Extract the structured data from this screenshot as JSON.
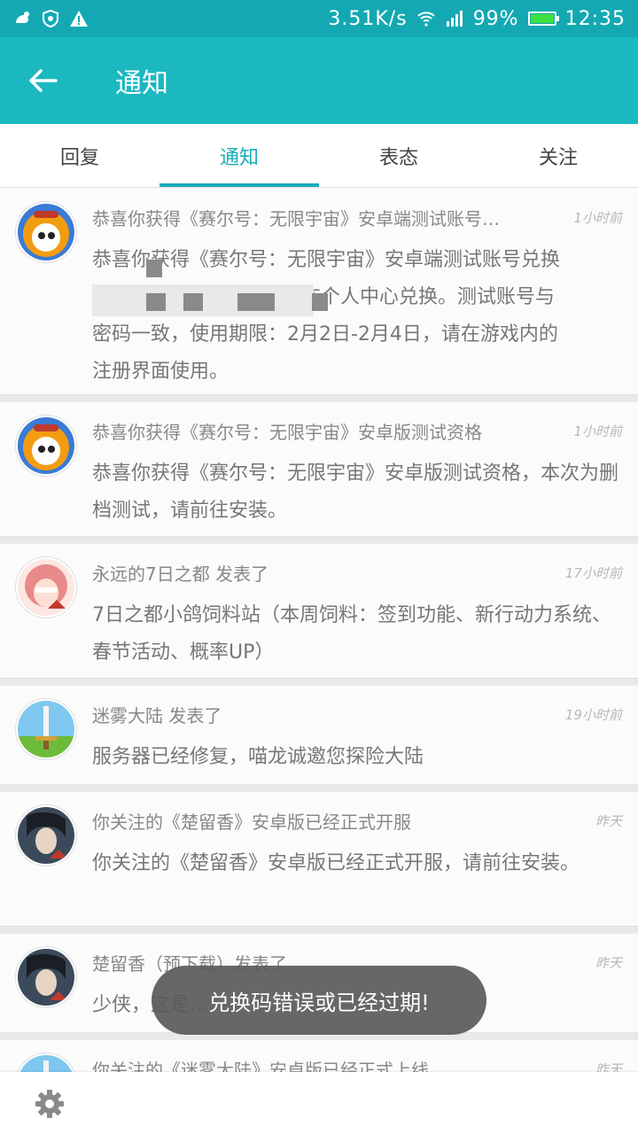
{
  "statusbar": {
    "speed": "3.51K/s",
    "battery": "99%",
    "time": "12:35",
    "battery_level": 0.99
  },
  "appbar": {
    "title": "通知"
  },
  "tabs": [
    {
      "label": "回复",
      "active": false
    },
    {
      "label": "通知",
      "active": true
    },
    {
      "label": "表态",
      "active": false
    },
    {
      "label": "关注",
      "active": false
    }
  ],
  "items": [
    {
      "title": "恭喜你获得《赛尔号：无限宇宙》安卓端测试账号…",
      "time": "1小时前",
      "body_line1": "恭喜你获得《赛尔号：无限宇宙》安卓端测试账号兑换",
      "body_line2": "在个人中心兑换。测试账号与",
      "body_line3": "密码一致，使用期限：2月2日-2月4日，请在游戏内的",
      "body_line4": "注册界面使用。",
      "avatar": "seer-avatar"
    },
    {
      "title": "恭喜你获得《赛尔号：无限宇宙》安卓版测试资格",
      "time": "1小时前",
      "body": "恭喜你获得《赛尔号：无限宇宙》安卓版测试资格，本次为删档测试，请前往安装。",
      "avatar": "seer-avatar"
    },
    {
      "title": "永远的7日之都 发表了",
      "time": "17小时前",
      "body": "7日之都小鸽饲料站（本周饲料：签到功能、新行动力系统、春节活动、概率UP）",
      "avatar": "anime-girl-avatar"
    },
    {
      "title": "迷雾大陆 发表了",
      "time": "19小时前",
      "body": "服务器已经修复，喵龙诚邀您探险大陆",
      "avatar": "sword-avatar"
    },
    {
      "title": "你关注的《楚留香》安卓版已经正式开服",
      "time": "昨天",
      "body": "你关注的《楚留香》安卓版已经正式开服，请前往安装。",
      "avatar": "chuliuxiang-avatar"
    },
    {
      "title": "楚留香（预下载）发表了",
      "time": "昨天",
      "body": "少侠，这是...",
      "avatar": "chuliuxiang-avatar"
    },
    {
      "title": "你关注的《迷雾大陆》安卓版已经正式上线",
      "time": "昨天",
      "avatar": "sword-avatar"
    }
  ],
  "toast": {
    "text": "兑换码错误或已经过期!"
  },
  "bottom": {
    "settings_icon": "gear-icon"
  },
  "colors": {
    "accent": "#1bb8c0",
    "statusbar": "#14a9b2"
  }
}
